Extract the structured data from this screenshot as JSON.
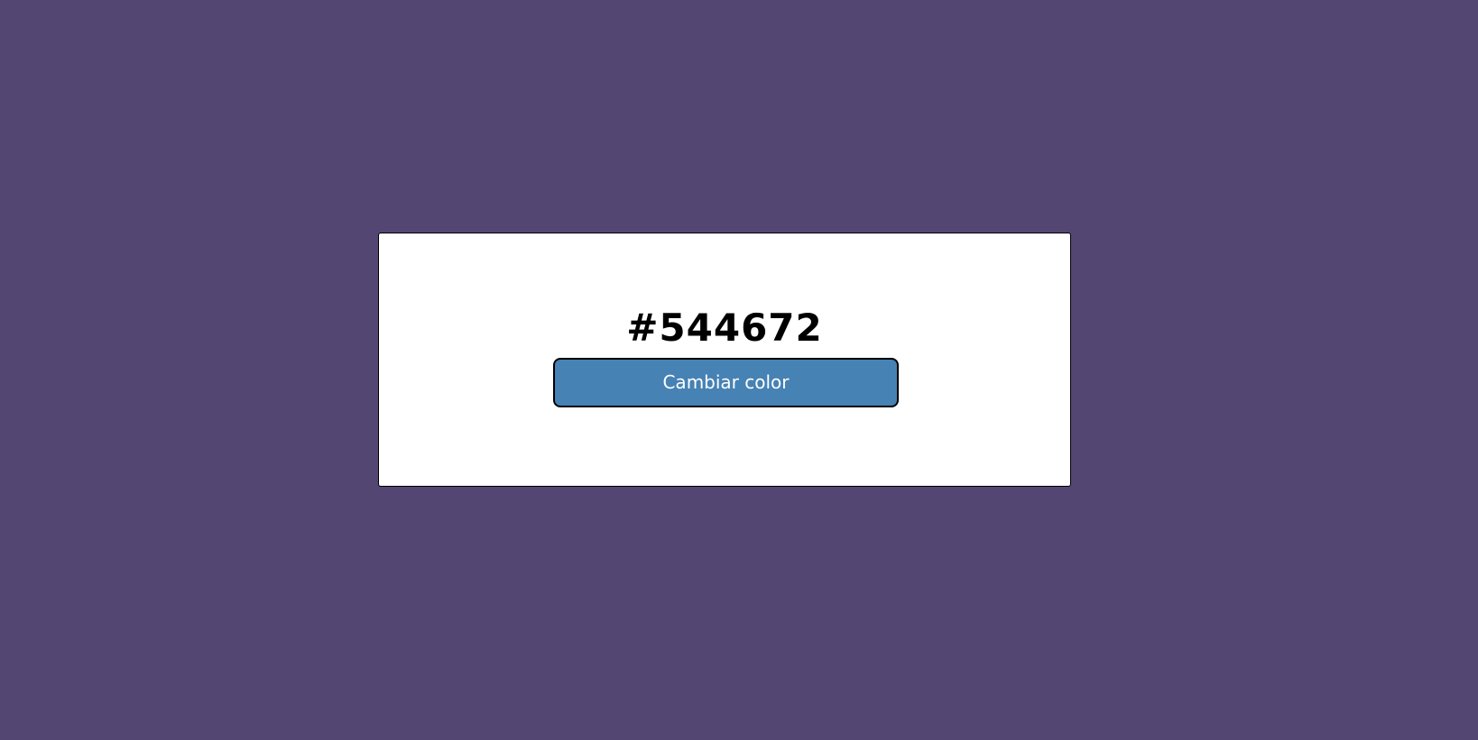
{
  "page": {
    "background_color": "#544672"
  },
  "card": {
    "hex_value": "#544672",
    "button_label": "Cambiar color",
    "button_color": "#4682b4",
    "card_color": "#ffffff"
  }
}
